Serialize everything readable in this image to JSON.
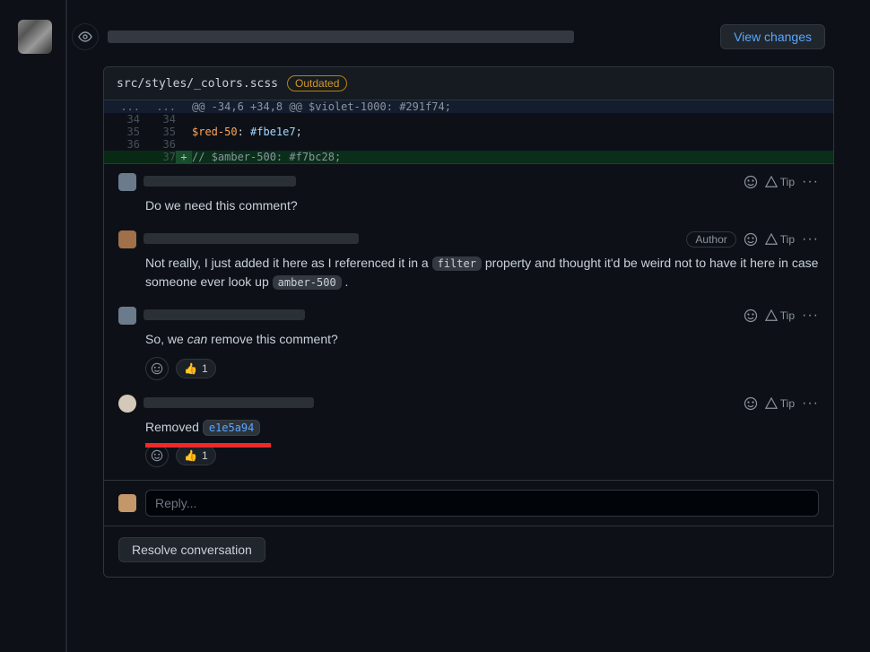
{
  "header": {
    "view_changes": "View changes"
  },
  "diff": {
    "file_path": "src/styles/_colors.scss",
    "outdated_label": "Outdated",
    "hunk_header": "@@ -34,6 +34,8 @@ $violet-1000: #291f74;",
    "lines": [
      {
        "old": "34",
        "new": "34",
        "sign": " ",
        "code": ""
      },
      {
        "old": "35",
        "new": "35",
        "sign": " ",
        "code_parts": [
          "$red-50",
          ": ",
          "#fbe1e7",
          ";"
        ]
      },
      {
        "old": "36",
        "new": "36",
        "sign": " ",
        "code": ""
      },
      {
        "old": "",
        "new": "37",
        "sign": "+",
        "code_comment": "// $amber-500: #f7bc28;"
      }
    ],
    "ellipsis": "..."
  },
  "comments": [
    {
      "body_plain": "Do we need this comment?",
      "author_badge": null,
      "reactions": null
    },
    {
      "body_pre": "Not really, I just added it here as I referenced it in a ",
      "code1": "filter",
      "body_mid": " property and thought it'd be weird not to have it here in case someone ever look up ",
      "code2": "amber-500",
      "body_post": " .",
      "author_badge": "Author",
      "reactions": null
    },
    {
      "body_pre": "So, we ",
      "em": "can",
      "body_post": " remove this comment?",
      "author_badge": null,
      "reactions": {
        "emoji": "👍",
        "count": "1"
      }
    },
    {
      "body_pre": "Removed ",
      "sha": "e1e5a94",
      "author_badge": null,
      "reactions": {
        "emoji": "👍",
        "count": "1"
      },
      "underline": true
    }
  ],
  "actions": {
    "tip_label": "Tip"
  },
  "reply": {
    "placeholder": "Reply..."
  },
  "resolve": {
    "label": "Resolve conversation"
  }
}
